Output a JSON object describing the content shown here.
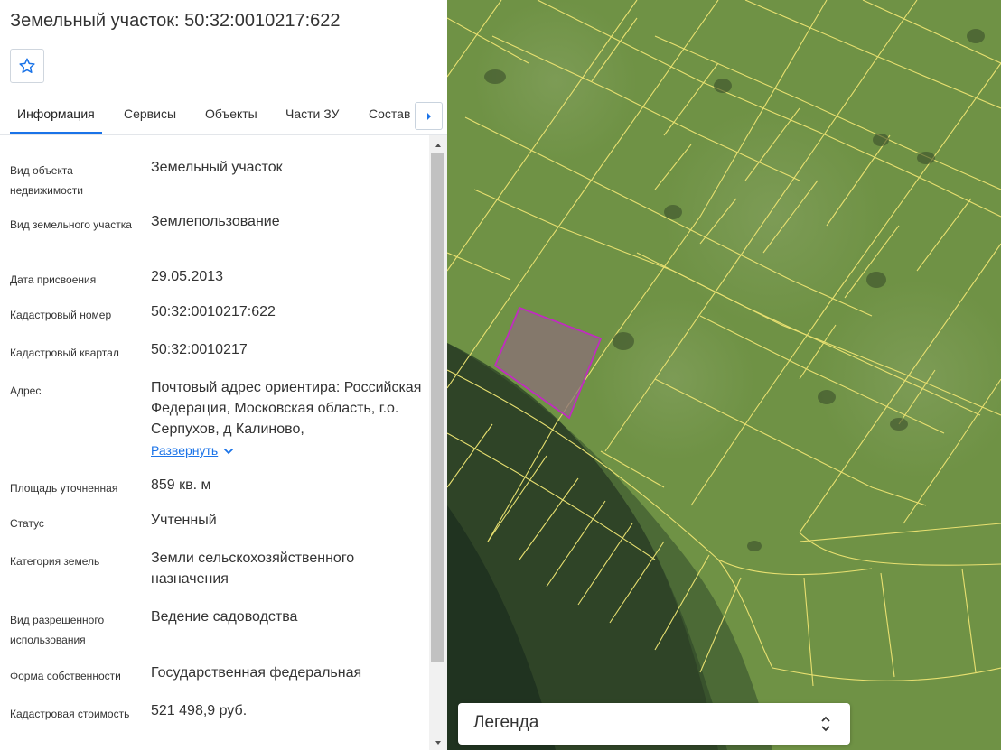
{
  "header": {
    "title": "Земельный участок: 50:32:0010217:622"
  },
  "favorite": {
    "icon": "star-icon"
  },
  "tabs": [
    {
      "label": "Информация",
      "active": true
    },
    {
      "label": "Сервисы"
    },
    {
      "label": "Объекты"
    },
    {
      "label": "Части ЗУ"
    },
    {
      "label": "Состав"
    }
  ],
  "tabs_next_icon": "caret-right-icon",
  "info": {
    "rows": [
      {
        "label": "Вид объекта недвижимости",
        "value": "Земельный участок"
      },
      {
        "label": "Вид земельного участка",
        "value": "Землепользование"
      },
      {
        "label": "Дата присвоения",
        "value": "29.05.2013"
      },
      {
        "label": "Кадастровый номер",
        "value": "50:32:0010217:622"
      },
      {
        "label": "Кадастровый квартал",
        "value": "50:32:0010217"
      },
      {
        "label": "Адрес",
        "value": "Почтовый адрес ориентира: Российская Федерация, Московская область, г.о. Серпухов, д Калиново,",
        "expand_label": "Развернуть"
      },
      {
        "label": "Площадь уточненная",
        "value": "859 кв. м"
      },
      {
        "label": "Статус",
        "value": "Учтенный"
      },
      {
        "label": "Категория земель",
        "value": "Земли сельскохозяйственного назначения"
      },
      {
        "label": "Вид разрешенного использования",
        "value": "Ведение садоводства"
      },
      {
        "label": "Форма собственности",
        "value": "Государственная федеральная"
      },
      {
        "label": "Кадастровая стоимость",
        "value": "521 498,9 руб."
      }
    ]
  },
  "map": {
    "legend_label": "Легенда",
    "parcel_border_color": "#e8e070",
    "selected_parcel_color": "#c02cc0",
    "accent": "#1a73e8"
  }
}
